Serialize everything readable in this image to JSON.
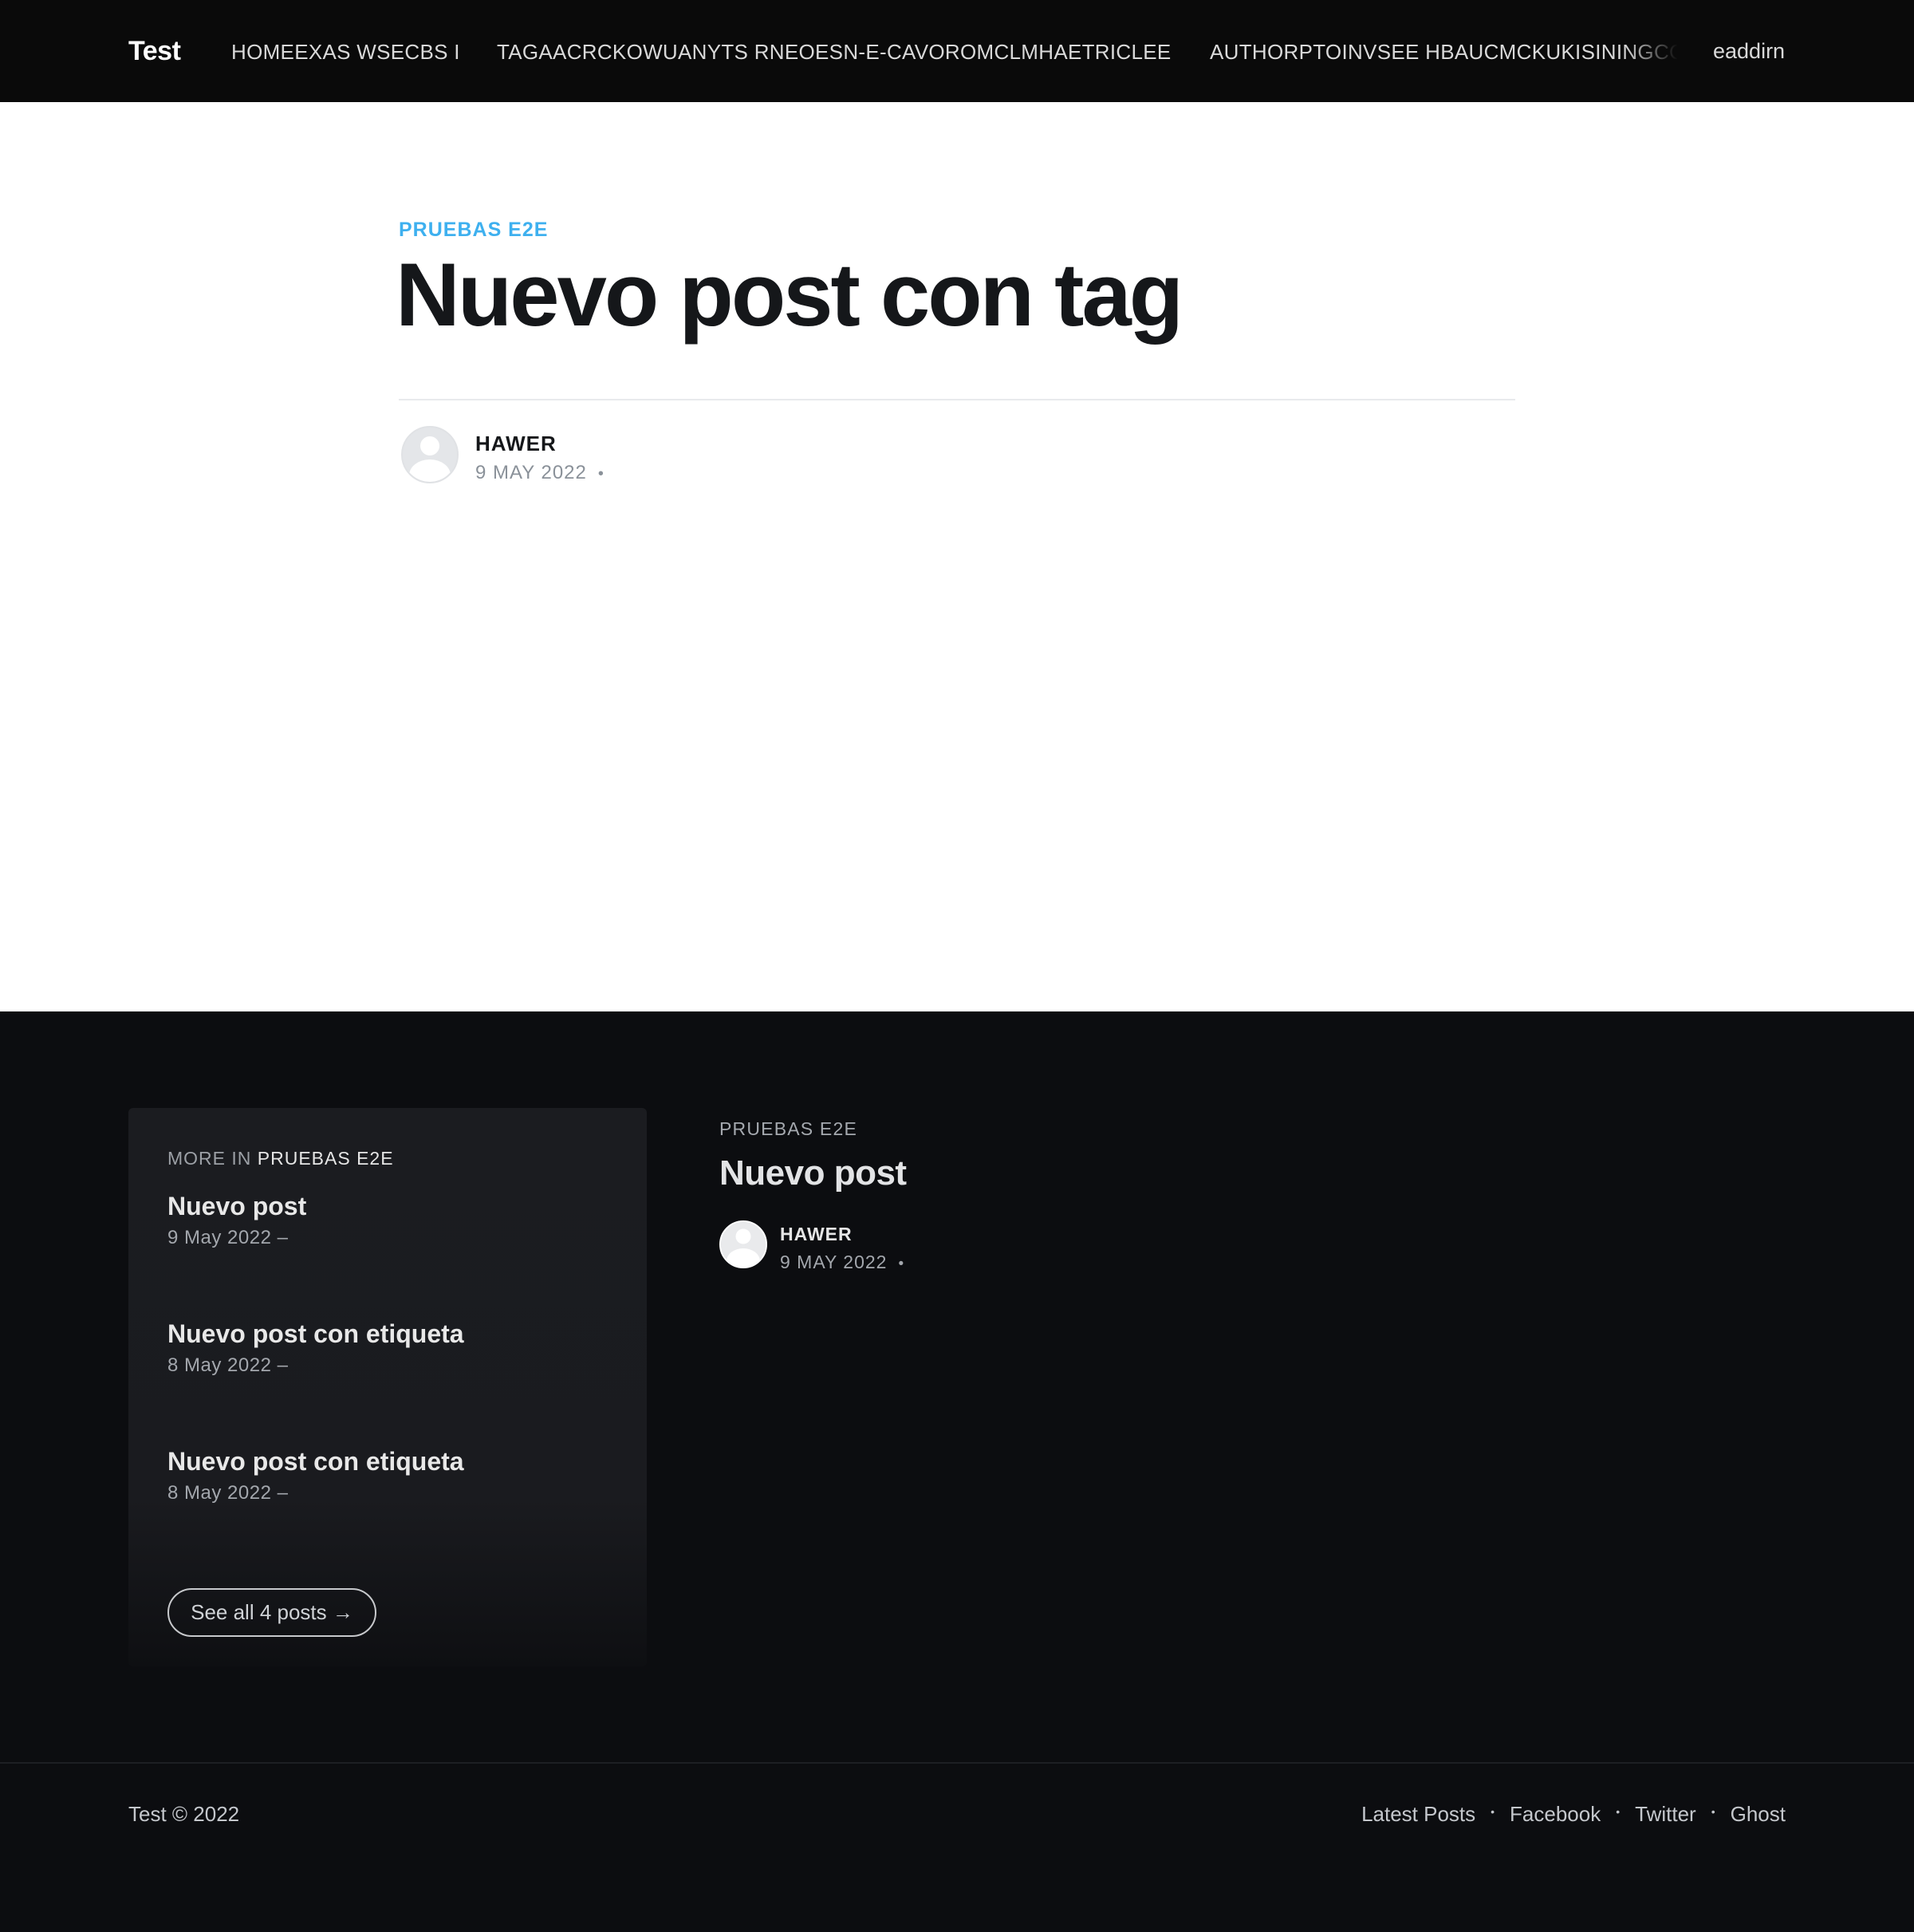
{
  "header": {
    "logo": "Test",
    "nav": [
      "HOMEEXAS WSECBS I",
      "TAGAACRCKOWUANYTS RNEOESN-E-CAVOROMCLMHAETRICLEE",
      "AUTHORPTOINVSEE HBAUCMCKUKISININGCC"
    ],
    "extra": "eaddirn"
  },
  "article": {
    "tag": "PRUEBAS E2E",
    "title": "Nuevo post con tag",
    "author": "HAWER",
    "date": "9 MAY 2022",
    "meta_separator": "•"
  },
  "read_more": {
    "card": {
      "heading_prefix": "MORE IN",
      "heading_tag": "PRUEBAS E2E",
      "items": [
        {
          "title": "Nuevo post",
          "date": "9 May 2022 –"
        },
        {
          "title": "Nuevo post con etiqueta",
          "date": "8 May 2022 –"
        },
        {
          "title": "Nuevo post con etiqueta",
          "date": "8 May 2022 –"
        }
      ],
      "see_all": "See all 4 posts →"
    },
    "post_card": {
      "tag": "PRUEBAS E2E",
      "title": "Nuevo post",
      "author": "HAWER",
      "date": "9 MAY 2022",
      "meta_separator": "•"
    }
  },
  "footer": {
    "copyright": "Test © 2022",
    "links": [
      "Latest Posts",
      "Facebook",
      "Twitter",
      "Ghost"
    ],
    "separator": "•"
  },
  "colors": {
    "header_bg": "#0a0a0a",
    "accent": "#3eb0ef",
    "dark_bg": "#0c0d10",
    "card_bg": "#1b1c20"
  },
  "icons": {
    "author_avatar": "user-avatar-icon",
    "see_all_arrow": "arrow-right-icon"
  }
}
